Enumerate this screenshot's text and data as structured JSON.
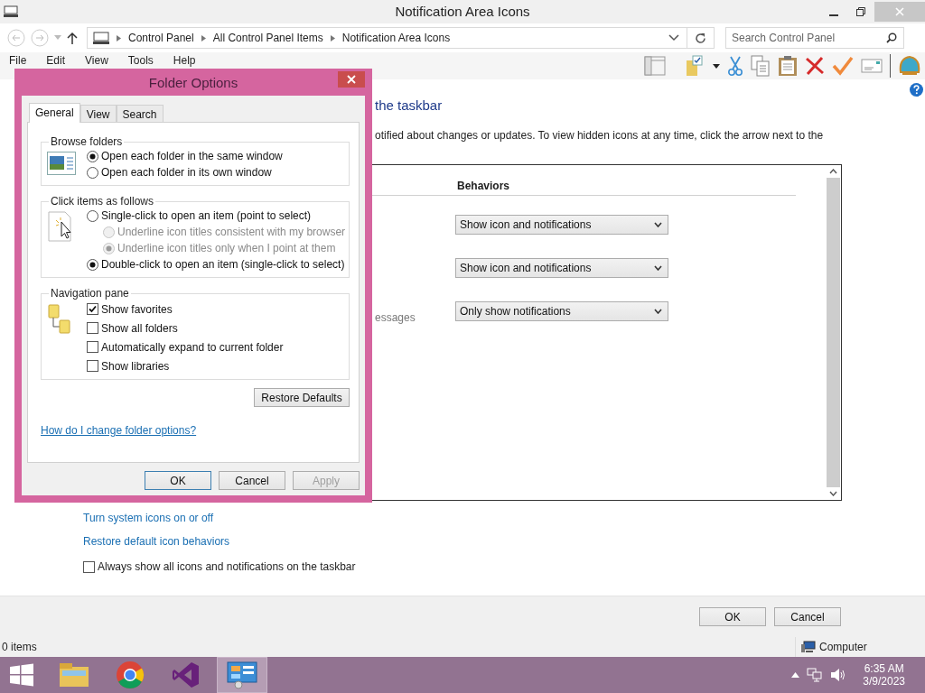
{
  "window": {
    "title": "Notification Area Icons"
  },
  "address_bar": {
    "breadcrumbs": [
      "Control Panel",
      "All Control Panel Items",
      "Notification Area Icons"
    ],
    "search": {
      "placeholder": "Search Control Panel"
    }
  },
  "menu": [
    "File",
    "Edit",
    "View",
    "Tools",
    "Help"
  ],
  "content": {
    "heading": "the taskbar",
    "description": "otified about changes or updates. To view hidden icons at any time, click the arrow next to the",
    "table": {
      "columns": [
        "Behaviors"
      ],
      "rows": [
        {
          "behavior": "Show icon and notifications"
        },
        {
          "behavior": "Show icon and notifications"
        },
        {
          "column_1": "essages",
          "behavior": "Only show notifications"
        }
      ]
    },
    "links": [
      "Turn system icons on or off",
      "Restore default icon behaviors"
    ],
    "always_show": {
      "label": "Always show all icons and notifications on the taskbar",
      "checked": false
    }
  },
  "buttons": [
    "OK",
    "Cancel"
  ],
  "status_bar": {
    "items": "0 items",
    "zone": "Computer"
  },
  "dialog": {
    "title": "Folder Options",
    "tabs": [
      {
        "label": "General",
        "selected": true
      },
      {
        "label": "View",
        "selected": false
      },
      {
        "label": "Search",
        "selected": false
      }
    ],
    "groups": [
      {
        "kind": "radio",
        "title": "Browse folders",
        "options": [
          {
            "label": "Open each folder in the same window",
            "selected": true,
            "disabled": false
          },
          {
            "label": "Open each folder in its own window",
            "selected": false,
            "disabled": false
          }
        ]
      },
      {
        "kind": "radio",
        "title": "Click items as follows",
        "options": [
          {
            "label": "Single-click to open an item (point to select)",
            "selected": false,
            "disabled": false,
            "children": [
              {
                "label": "Underline icon titles consistent with my browser",
                "selected": false,
                "disabled": true
              },
              {
                "label": "Underline icon titles only when I point at them",
                "selected": true,
                "disabled": true
              }
            ]
          },
          {
            "label": "Double-click to open an item (single-click to select)",
            "selected": true,
            "disabled": false
          }
        ]
      },
      {
        "kind": "check",
        "title": "Navigation pane",
        "options": [
          {
            "label": "Show favorites",
            "checked": true
          },
          {
            "label": "Show all folders",
            "checked": false
          },
          {
            "label": "Automatically expand to current folder",
            "checked": false
          },
          {
            "label": "Show libraries",
            "checked": false
          }
        ]
      }
    ],
    "restore": "Restore Defaults",
    "help_link": "How do I change folder options?",
    "buttons": [
      {
        "label": "OK",
        "disabled": false
      },
      {
        "label": "Cancel",
        "disabled": false
      },
      {
        "label": "Apply",
        "disabled": true
      }
    ]
  },
  "taskbar": {
    "apps": [
      {
        "kind": "explorer",
        "selected": false
      },
      {
        "kind": "browser",
        "selected": false
      },
      {
        "kind": "studio",
        "selected": false
      },
      {
        "kind": "panel",
        "selected": true
      }
    ],
    "time": "6:35 AM",
    "date": "3/9/2023"
  }
}
